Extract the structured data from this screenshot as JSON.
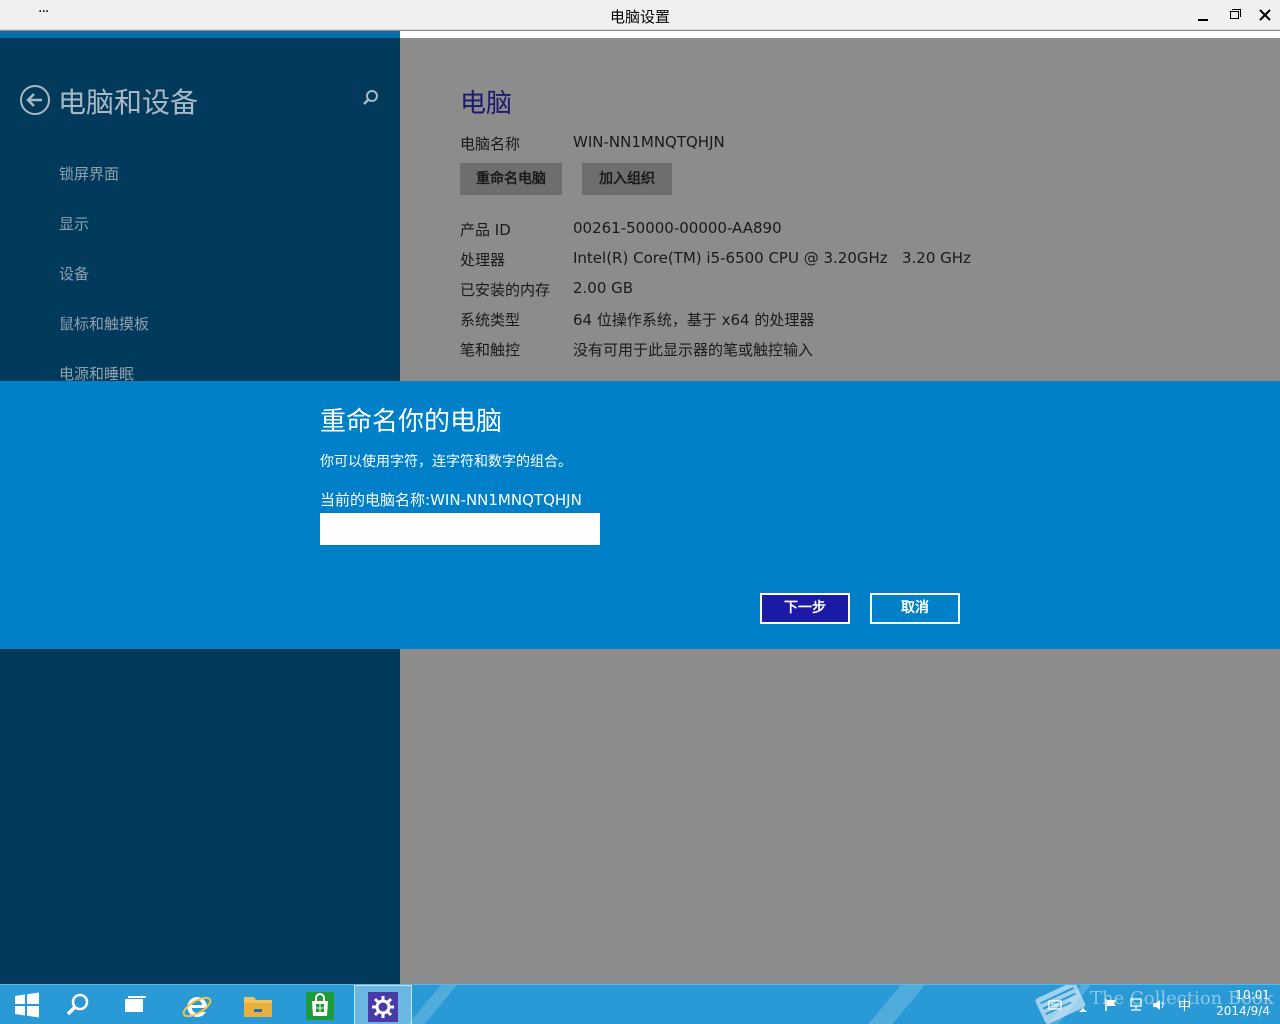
{
  "window": {
    "title": "电脑设置",
    "menu_glyph": "···"
  },
  "sidebar": {
    "heading": "电脑和设备",
    "items": [
      {
        "label": "锁屏界面"
      },
      {
        "label": "显示"
      },
      {
        "label": "设备"
      },
      {
        "label": "鼠标和触摸板"
      },
      {
        "label": "电源和睡眠"
      }
    ]
  },
  "main": {
    "section_title": "电脑",
    "pc_name_label": "电脑名称",
    "pc_name_value": "WIN-NN1MNQTQHJN",
    "rename_button": "重命名电脑",
    "join_org_button": "加入组织",
    "properties": [
      {
        "label": "产品 ID",
        "value": "00261-50000-00000-AA890"
      },
      {
        "label": "处理器",
        "value": "Intel(R) Core(TM) i5-6500 CPU @ 3.20GHz   3.20 GHz"
      },
      {
        "label": "已安装的内存",
        "value": "2.00 GB"
      },
      {
        "label": "系统类型",
        "value": "64 位操作系统，基于 x64 的处理器"
      },
      {
        "label": "笔和触控",
        "value": "没有可用于此显示器的笔或触控输入"
      }
    ]
  },
  "dialog": {
    "title": "重命名你的电脑",
    "description": "你可以使用字符，连字符和数字的组合。",
    "current_name_label": "当前的电脑名称:",
    "current_name_value": "WIN-NN1MNQTQHJN",
    "input_value": "",
    "next_button": "下一步",
    "cancel_button": "取消"
  },
  "taskbar": {
    "apps": [
      "start-icon",
      "search-icon",
      "task-view-icon",
      "internet-explorer-icon",
      "file-explorer-icon",
      "store-icon",
      "settings-icon"
    ],
    "tray": {
      "ime_label": "中",
      "time": "10:01",
      "date": "2014/9/4"
    },
    "watermark": "The Collection Book"
  },
  "colors": {
    "sidebar_bg": "#023a5c",
    "content_bg": "#8c8c8c",
    "dialog_bg": "#0080c8",
    "primary_button": "#1a1aa6",
    "section_title": "#1a1a6e",
    "taskbar": "#2a9ad6"
  }
}
